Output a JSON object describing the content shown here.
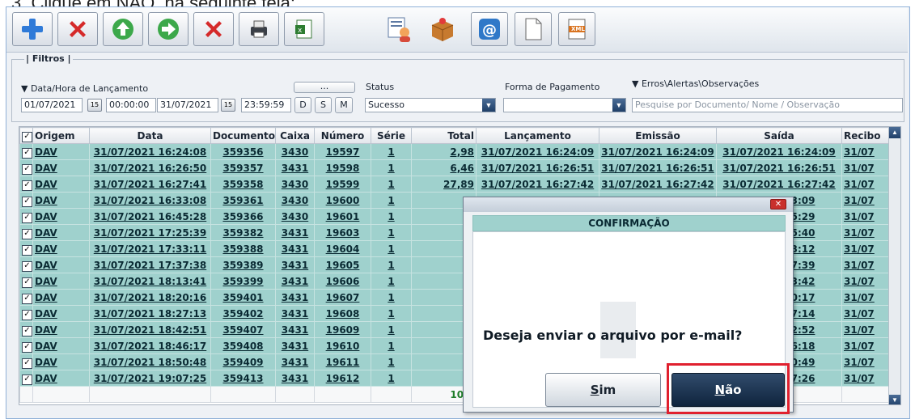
{
  "instruction": {
    "text": "3.   Clique em NÃO, na seguinte tela:"
  },
  "toolbar": {
    "icons": [
      "add-icon",
      "delete-icon",
      "upload-icon",
      "forward-icon",
      "cancel-icon",
      "print-icon",
      "excel-icon",
      "report-icon",
      "package-icon",
      "email-icon",
      "document-icon",
      "xml-icon"
    ],
    "xml_label": "XML"
  },
  "filters": {
    "group_label": "| Filtros |",
    "date_label": "▼ Data/Hora de Lançamento",
    "date_from": "01/07/2021",
    "time_from": "00:00:00",
    "date_to": "31/07/2021",
    "time_to": "23:59:59",
    "ellipsis_btn": "...",
    "btn_d": "D",
    "btn_s": "S",
    "btn_m": "M",
    "status_label": "Status",
    "status_value": "Sucesso",
    "payment_label": "Forma de Pagamento",
    "payment_value": "",
    "errors_label": "▼ Erros\\Alertas\\Observações",
    "search_placeholder": "Pesquise por Documento/ Nome / Observação"
  },
  "grid": {
    "columns": [
      "Origem",
      "Data",
      "Documento",
      "Caixa",
      "Número",
      "Série",
      "Total",
      "Lançamento",
      "Emissão",
      "Saída",
      "Recibo"
    ],
    "rows": [
      [
        "DAV",
        "31/07/2021 16:24:08",
        "359356",
        "3430",
        "19597",
        "1",
        "2,98",
        "31/07/2021 16:24:09",
        "31/07/2021 16:24:09",
        "31/07/2021 16:24:09",
        "31/07"
      ],
      [
        "DAV",
        "31/07/2021 16:26:50",
        "359357",
        "3431",
        "19598",
        "1",
        "6,46",
        "31/07/2021 16:26:51",
        "31/07/2021 16:26:51",
        "31/07/2021 16:26:51",
        "31/07"
      ],
      [
        "DAV",
        "31/07/2021 16:27:41",
        "359358",
        "3430",
        "19599",
        "1",
        "27,89",
        "31/07/2021 16:27:42",
        "31/07/2021 16:27:42",
        "31/07/2021 16:27:42",
        "31/07"
      ],
      [
        "DAV",
        "31/07/2021 16:33:08",
        "359361",
        "3430",
        "19600",
        "1",
        "",
        "",
        "",
        "021 16:33:09",
        "31/07"
      ],
      [
        "DAV",
        "31/07/2021 16:45:28",
        "359366",
        "3430",
        "19601",
        "1",
        "",
        "",
        "",
        "021 16:45:29",
        "31/07"
      ],
      [
        "DAV",
        "31/07/2021 17:25:39",
        "359382",
        "3431",
        "19603",
        "1",
        "",
        "",
        "",
        "021 17:25:40",
        "31/07"
      ],
      [
        "DAV",
        "31/07/2021 17:33:11",
        "359388",
        "3431",
        "19604",
        "1",
        "",
        "",
        "",
        "021 17:33:12",
        "31/07"
      ],
      [
        "DAV",
        "31/07/2021 17:37:38",
        "359389",
        "3431",
        "19605",
        "1",
        "",
        "",
        "",
        "021 17:37:39",
        "31/07"
      ],
      [
        "DAV",
        "31/07/2021 18:13:41",
        "359399",
        "3431",
        "19606",
        "1",
        "",
        "",
        "",
        "021 18:13:42",
        "31/07"
      ],
      [
        "DAV",
        "31/07/2021 18:20:16",
        "359401",
        "3431",
        "19607",
        "1",
        "",
        "",
        "",
        "021 18:20:17",
        "31/07"
      ],
      [
        "DAV",
        "31/07/2021 18:27:13",
        "359402",
        "3431",
        "19608",
        "1",
        "",
        "",
        "",
        "021 18:27:14",
        "31/07"
      ],
      [
        "DAV",
        "31/07/2021 18:42:51",
        "359407",
        "3431",
        "19609",
        "1",
        "",
        "",
        "",
        "021 18:42:52",
        "31/07"
      ],
      [
        "DAV",
        "31/07/2021 18:46:17",
        "359408",
        "3431",
        "19610",
        "1",
        "",
        "",
        "",
        "021 18:46:18",
        "31/07"
      ],
      [
        "DAV",
        "31/07/2021 18:50:48",
        "359409",
        "3431",
        "19611",
        "1",
        "",
        "",
        "",
        "021 18:50:49",
        "31/07"
      ],
      [
        "DAV",
        "31/07/2021 19:07:25",
        "359413",
        "3431",
        "19612",
        "1",
        "",
        "",
        "",
        "021 19:07:26",
        "31/07"
      ]
    ],
    "footer_total": "101."
  },
  "dialog": {
    "header": "CONFIRMAÇÃO",
    "question": "Deseja enviar o arquivo por e-mail?",
    "yes_mnemonic": "S",
    "yes_rest": "im",
    "no_mnemonic": "N",
    "no_rest": "ão"
  },
  "colors": {
    "row_bg": "#9fd1cd",
    "highlight": "#e0202e",
    "no_button": "#0f243d"
  }
}
